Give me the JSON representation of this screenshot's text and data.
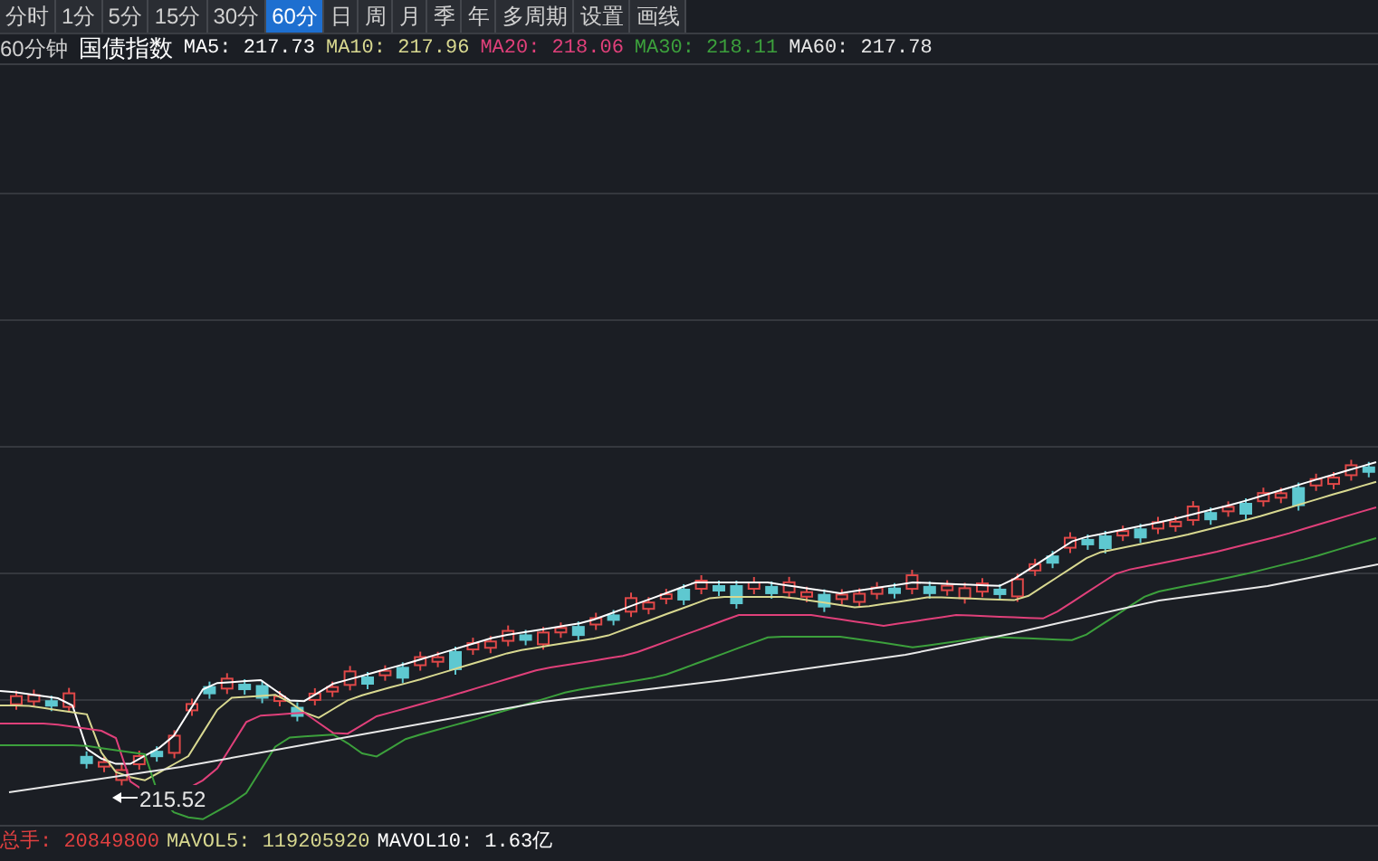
{
  "tabs": [
    {
      "label": "分时",
      "selected": false
    },
    {
      "label": "1分",
      "selected": false
    },
    {
      "label": "5分",
      "selected": false
    },
    {
      "label": "15分",
      "selected": false
    },
    {
      "label": "30分",
      "selected": false
    },
    {
      "label": "60分",
      "selected": true
    },
    {
      "label": "日",
      "selected": false
    },
    {
      "label": "周",
      "selected": false
    },
    {
      "label": "月",
      "selected": false
    },
    {
      "label": "季",
      "selected": false
    },
    {
      "label": "年",
      "selected": false
    },
    {
      "label": "多周期",
      "selected": false
    },
    {
      "label": "设置",
      "selected": false
    },
    {
      "label": "画线",
      "selected": false
    }
  ],
  "legend": {
    "period": "60分钟",
    "name": "国债指数",
    "averages": [
      {
        "label": "MA5:",
        "value": "217.73",
        "color": "#ffffff"
      },
      {
        "label": "MA10:",
        "value": "217.96",
        "color": "#d8d890"
      },
      {
        "label": "MA20:",
        "value": "218.06",
        "color": "#e0407a"
      },
      {
        "label": "MA30:",
        "value": "218.11",
        "color": "#3ca03c"
      },
      {
        "label": "MA60:",
        "value": "217.78",
        "color": "#e8e8e8"
      }
    ]
  },
  "chart": {
    "low_label": "215.52"
  },
  "volume": [
    {
      "label": "总手:",
      "value": "20849800",
      "color": "#e04040"
    },
    {
      "label": "MAVOL5:",
      "value": "119205920",
      "color": "#d8d890"
    },
    {
      "label": "MAVOL10:",
      "value": "1.63亿",
      "color": "#ffffff"
    }
  ]
}
